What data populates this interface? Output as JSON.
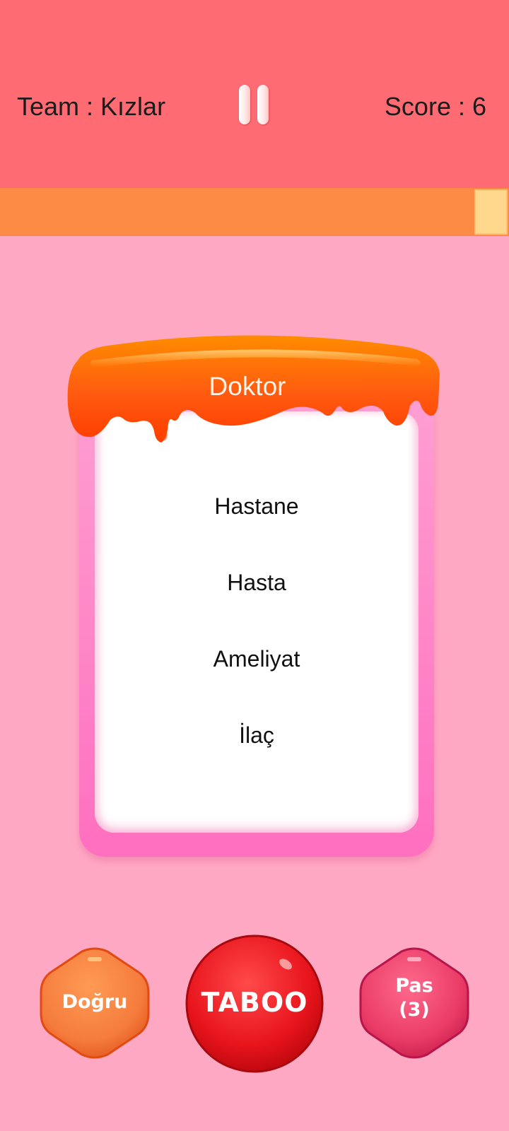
{
  "header": {
    "team_label": "Team : Kızlar",
    "score_label": "Score : 6",
    "pause_icon": "pause-icon"
  },
  "timer": {
    "remaining_fraction": 0.065,
    "track_color": "#fe8b45",
    "fill_color": "#ffd88e"
  },
  "card": {
    "word": "Doktor",
    "forbidden_words": [
      "Hastane",
      "Hasta",
      "Ameliyat",
      "İlaç"
    ],
    "cap_color": "#ff5a10",
    "frame_color": "#ff7fc6"
  },
  "actions": {
    "correct_label": "Doğru",
    "taboo_label": "TABOO",
    "pass_label_line1": "Pas",
    "pass_label_line2": "(3)"
  },
  "colors": {
    "background": "#ffa8c4",
    "header": "#fe6b73",
    "correct_button": "#f57c3c",
    "taboo_button": "#e8141c",
    "pass_button": "#ea3b66"
  }
}
